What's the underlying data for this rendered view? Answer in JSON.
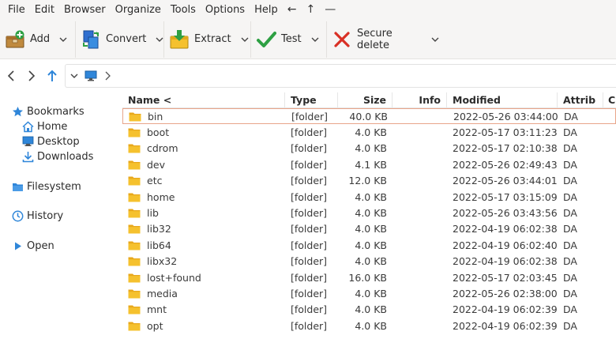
{
  "menubar": {
    "items": [
      "File",
      "Edit",
      "Browser",
      "Organize",
      "Tools",
      "Options",
      "Help"
    ],
    "back_glyph": "←",
    "up_glyph": "↑",
    "minimize_glyph": "—"
  },
  "toolbar": {
    "add_label": "Add",
    "convert_label": "Convert",
    "extract_label": "Extract",
    "test_label": "Test",
    "secure_delete_label": "Secure delete"
  },
  "sidebar": {
    "bookmarks": "Bookmarks",
    "home": "Home",
    "desktop": "Desktop",
    "downloads": "Downloads",
    "filesystem": "Filesystem",
    "history": "History",
    "open": "Open"
  },
  "columns": {
    "name": "Name <",
    "type": "Type",
    "size": "Size",
    "info": "Info",
    "modified": "Modified",
    "attrib": "Attrib",
    "crc": "CR"
  },
  "files": [
    {
      "name": "bin",
      "type": "[folder]",
      "size": "40.0 KB",
      "info": "",
      "modified": "2022-05-26 03:44:00",
      "attrib": "DA"
    },
    {
      "name": "boot",
      "type": "[folder]",
      "size": "4.0 KB",
      "info": "",
      "modified": "2022-05-17 03:11:23",
      "attrib": "DA"
    },
    {
      "name": "cdrom",
      "type": "[folder]",
      "size": "4.0 KB",
      "info": "",
      "modified": "2022-05-17 02:10:38",
      "attrib": "DA"
    },
    {
      "name": "dev",
      "type": "[folder]",
      "size": "4.1 KB",
      "info": "",
      "modified": "2022-05-26 02:49:43",
      "attrib": "DA"
    },
    {
      "name": "etc",
      "type": "[folder]",
      "size": "12.0 KB",
      "info": "",
      "modified": "2022-05-26 03:44:01",
      "attrib": "DA"
    },
    {
      "name": "home",
      "type": "[folder]",
      "size": "4.0 KB",
      "info": "",
      "modified": "2022-05-17 03:15:09",
      "attrib": "DA"
    },
    {
      "name": "lib",
      "type": "[folder]",
      "size": "4.0 KB",
      "info": "",
      "modified": "2022-05-26 03:43:56",
      "attrib": "DA"
    },
    {
      "name": "lib32",
      "type": "[folder]",
      "size": "4.0 KB",
      "info": "",
      "modified": "2022-04-19 06:02:38",
      "attrib": "DA"
    },
    {
      "name": "lib64",
      "type": "[folder]",
      "size": "4.0 KB",
      "info": "",
      "modified": "2022-04-19 06:02:40",
      "attrib": "DA"
    },
    {
      "name": "libx32",
      "type": "[folder]",
      "size": "4.0 KB",
      "info": "",
      "modified": "2022-04-19 06:02:38",
      "attrib": "DA"
    },
    {
      "name": "lost+found",
      "type": "[folder]",
      "size": "16.0 KB",
      "info": "",
      "modified": "2022-05-17 02:03:45",
      "attrib": "DA"
    },
    {
      "name": "media",
      "type": "[folder]",
      "size": "4.0 KB",
      "info": "",
      "modified": "2022-05-26 02:38:00",
      "attrib": "DA"
    },
    {
      "name": "mnt",
      "type": "[folder]",
      "size": "4.0 KB",
      "info": "",
      "modified": "2022-04-19 06:02:39",
      "attrib": "DA"
    },
    {
      "name": "opt",
      "type": "[folder]",
      "size": "4.0 KB",
      "info": "",
      "modified": "2022-04-19 06:02:39",
      "attrib": "DA"
    }
  ],
  "selected_index": 0,
  "colors": {
    "accent_blue": "#2f86d9",
    "folder_yellow": "#f5c12e",
    "selection_border": "#e8a58a",
    "test_green": "#2ea043",
    "delete_red": "#d93025"
  }
}
